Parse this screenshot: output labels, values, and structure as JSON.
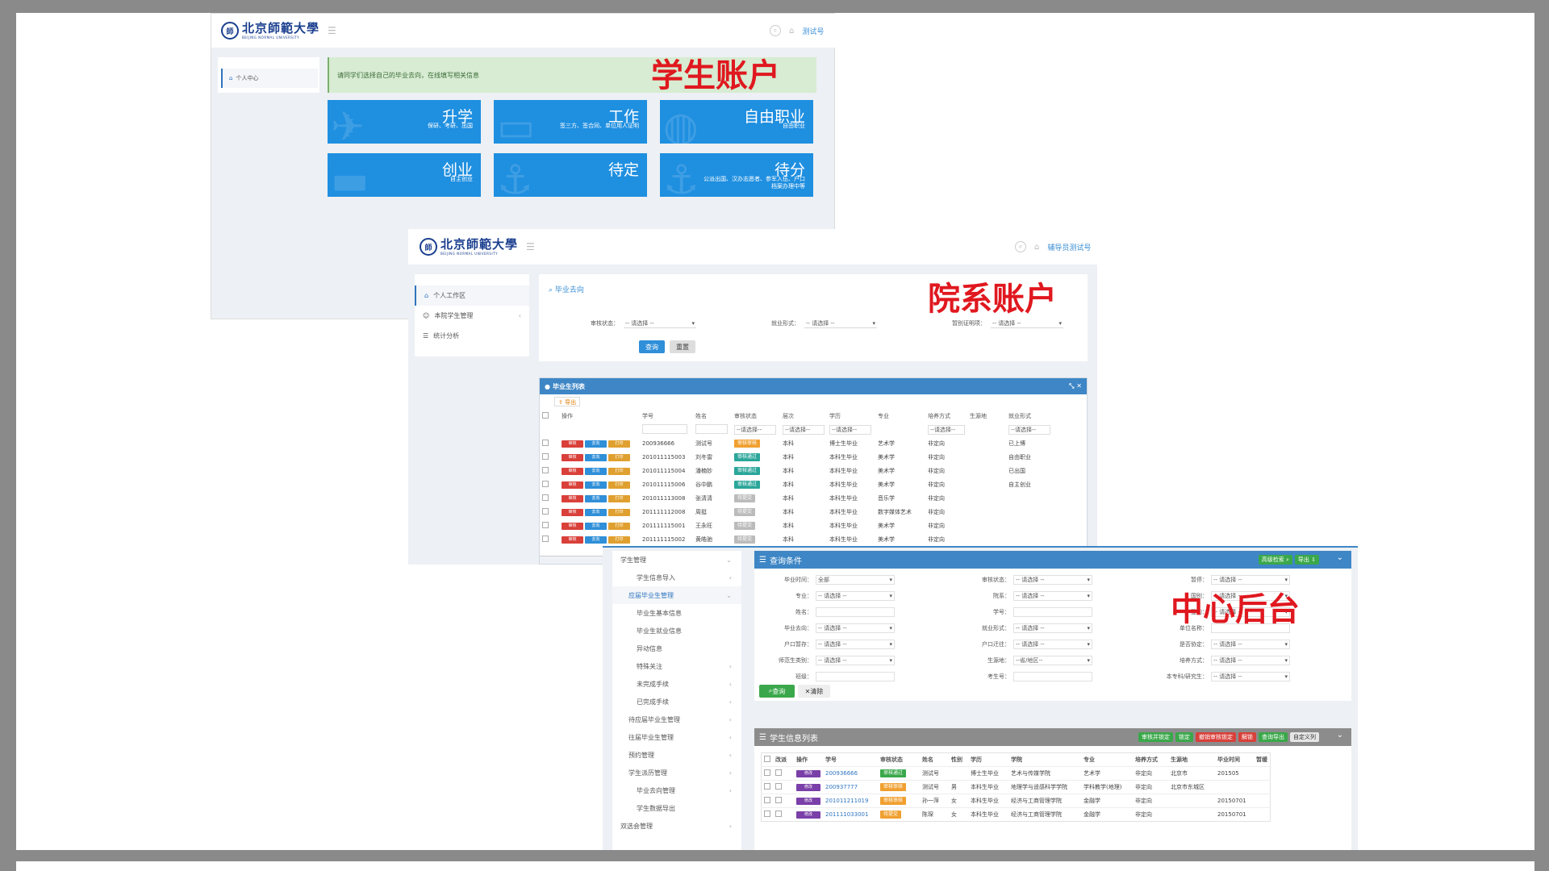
{
  "labels": {
    "student": "学生账户",
    "department": "院系账户",
    "center": "中心后台"
  },
  "logo": {
    "cn": "北京師範大學",
    "en": "BEIJING NORMAL UNIVERSITY"
  },
  "student": {
    "user": "测试号",
    "sidebar_item": "个人中心",
    "notice": "请同学们选择自己的毕业去向，在线填写相关信息",
    "tiles": [
      {
        "title": "升学",
        "sub": "保研、考研、出国"
      },
      {
        "title": "工作",
        "sub": "签三方、签合同、单位用人证明"
      },
      {
        "title": "自由职业",
        "sub": "自由职业"
      },
      {
        "title": "创业",
        "sub": "自主创业"
      },
      {
        "title": "待定",
        "sub": ""
      },
      {
        "title": "待分",
        "sub": "公派出国、汉办志愿者、参军入伍、户口档案办理中等"
      }
    ]
  },
  "department": {
    "user": "辅导员测试号",
    "sidebar": [
      "个人工作区",
      "本院学生管理",
      "统计分析"
    ],
    "search_title": "毕业去向",
    "filters": [
      {
        "label": "审核状态：",
        "value": "-- 请选择 --"
      },
      {
        "label": "就业形式：",
        "value": "-- 请选择 --"
      },
      {
        "label": "暂别证明项：",
        "value": "-- 请选择 --"
      }
    ],
    "btn_query": "查询",
    "btn_reset": "重置",
    "grid_title": "毕业生列表",
    "export": "导出",
    "columns": [
      "操作",
      "学号",
      "姓名",
      "审核状态",
      "层次",
      "学历",
      "专业",
      "培养方式",
      "生源地",
      "就业形式"
    ],
    "filter_value": "--请选择--",
    "op_labels": [
      "审核",
      "去向",
      "打印"
    ],
    "rows": [
      {
        "id": "200936666",
        "name": "测试号",
        "status": "审核审核",
        "status_color": "#f0a030",
        "level": "本科",
        "edu": "博士生毕业",
        "major": "艺术学",
        "mode": "非定向",
        "origin": "",
        "form": "已上博"
      },
      {
        "id": "201011115003",
        "name": "刘冬雷",
        "status": "审核通过",
        "status_color": "#2aa69a",
        "level": "本科",
        "edu": "本科生毕业",
        "major": "美术学",
        "mode": "非定向",
        "origin": "",
        "form": "自由职业"
      },
      {
        "id": "201011115004",
        "name": "潘楠妙",
        "status": "审核通过",
        "status_color": "#2aa69a",
        "level": "本科",
        "edu": "本科生毕业",
        "major": "美术学",
        "mode": "非定向",
        "origin": "",
        "form": "已出国"
      },
      {
        "id": "201011115006",
        "name": "谷中鹏",
        "status": "审核通过",
        "status_color": "#2aa69a",
        "level": "本科",
        "edu": "本科生毕业",
        "major": "美术学",
        "mode": "非定向",
        "origin": "",
        "form": "自主创业"
      },
      {
        "id": "201011113008",
        "name": "张清清",
        "status": "待提交",
        "status_color": "#bbbbbb",
        "level": "本科",
        "edu": "本科生毕业",
        "major": "音乐学",
        "mode": "非定向",
        "origin": "",
        "form": ""
      },
      {
        "id": "201111112008",
        "name": "周挺",
        "status": "待提交",
        "status_color": "#bbbbbb",
        "level": "本科",
        "edu": "本科生毕业",
        "major": "数字媒体艺术",
        "mode": "非定向",
        "origin": "",
        "form": ""
      },
      {
        "id": "201111115001",
        "name": "王永旺",
        "status": "待提交",
        "status_color": "#bbbbbb",
        "level": "本科",
        "edu": "本科生毕业",
        "major": "美术学",
        "mode": "非定向",
        "origin": "",
        "form": ""
      },
      {
        "id": "201111115002",
        "name": "黄皓驰",
        "status": "待提交",
        "status_color": "#bbbbbb",
        "level": "本科",
        "edu": "本科生毕业",
        "major": "美术学",
        "mode": "非定向",
        "origin": "",
        "form": ""
      }
    ]
  },
  "center": {
    "sidebar": [
      {
        "label": "学生管理",
        "indent": 0,
        "arrow": "⌄"
      },
      {
        "label": "学生信息导入",
        "indent": 2,
        "arrow": "‹"
      },
      {
        "label": "应届毕业生管理",
        "indent": 1,
        "arrow": "⌄"
      },
      {
        "label": "毕业生基本信息",
        "indent": 2,
        "arrow": ""
      },
      {
        "label": "毕业生就业信息",
        "indent": 2,
        "arrow": ""
      },
      {
        "label": "异动信息",
        "indent": 2,
        "arrow": ""
      },
      {
        "label": "特殊关注",
        "indent": 2,
        "arrow": "‹"
      },
      {
        "label": "未完成手续",
        "indent": 2,
        "arrow": "‹"
      },
      {
        "label": "已完成手续",
        "indent": 2,
        "arrow": "‹"
      },
      {
        "label": "待应届毕业生管理",
        "indent": 1,
        "arrow": "‹"
      },
      {
        "label": "往届毕业生管理",
        "indent": 1,
        "arrow": "‹"
      },
      {
        "label": "预约管理",
        "indent": 1,
        "arrow": "‹"
      },
      {
        "label": "学生派历管理",
        "indent": 1,
        "arrow": "‹"
      },
      {
        "label": "毕业去向管理",
        "indent": 2,
        "arrow": "‹"
      },
      {
        "label": "学生数据导出",
        "indent": 2,
        "arrow": ""
      },
      {
        "label": "双选会管理",
        "indent": 0,
        "arrow": "‹"
      }
    ],
    "query_title": "查询条件",
    "query_buttons": [
      "高级检索",
      "导出"
    ],
    "fields": [
      {
        "label": "毕业时间：",
        "value": "全部"
      },
      {
        "label": "审核状态：",
        "value": "-- 请选择 --"
      },
      {
        "label": "暂停：",
        "value": "-- 请选择 --"
      },
      {
        "label": "专业：",
        "value": "-- 请选择 --"
      },
      {
        "label": "院系：",
        "value": "-- 请选择 --"
      },
      {
        "label": "国别：",
        "value": "-- 请选择 --"
      },
      {
        "label": "姓名：",
        "value": ""
      },
      {
        "label": "学号：",
        "value": ""
      },
      {
        "label": "签约：",
        "value": "-- 请选择 --"
      },
      {
        "label": "毕业去向：",
        "value": "-- 请选择 --"
      },
      {
        "label": "就业形式：",
        "value": "-- 请选择 --"
      },
      {
        "label": "单位名称：",
        "value": ""
      },
      {
        "label": "户口暂存：",
        "value": "-- 请选择 --"
      },
      {
        "label": "户口迁往：",
        "value": "-- 请选择 --"
      },
      {
        "label": "是否协定：",
        "value": "-- 请选择 --"
      },
      {
        "label": "师范生类别：",
        "value": "-- 请选择 --"
      },
      {
        "label": "生源地：",
        "value": "--省/地区--"
      },
      {
        "label": "培养方式：",
        "value": "-- 请选择 --"
      },
      {
        "label": "班级：",
        "value": ""
      },
      {
        "label": "考生号：",
        "value": ""
      },
      {
        "label": "本专科/研究生：",
        "value": "-- 请选择 --"
      }
    ],
    "btn_query": "查询",
    "btn_clear": "清除",
    "list_title": "学生信息列表",
    "list_buttons": [
      {
        "label": "审核并锁定",
        "color": "#3aa84a"
      },
      {
        "label": "锁定",
        "color": "#3aa84a"
      },
      {
        "label": "撤销审核锁定",
        "color": "#d9403a"
      },
      {
        "label": "解锁",
        "color": "#d9403a"
      },
      {
        "label": "查询导出",
        "color": "#3aa84a"
      },
      {
        "label": "自定义列",
        "color": "#e6e6e6"
      }
    ],
    "columns": [
      "改派",
      "操作",
      "学号",
      "审核状态",
      "姓名",
      "性别",
      "学历",
      "学院",
      "专业",
      "培养方式",
      "生源地",
      "毕业时间",
      "暂缓"
    ],
    "edit_label": "修改",
    "rows": [
      {
        "id": "200936666",
        "status": "审核通过",
        "status_color": "#3aa84a",
        "name": "测试号",
        "gender": "",
        "edu": "博士生毕业",
        "college": "艺术与传媒学院",
        "major": "艺术学",
        "mode": "非定向",
        "origin": "北京市",
        "time": "201505"
      },
      {
        "id": "200937777",
        "status": "审核审核",
        "status_color": "#f0a030",
        "name": "测试号",
        "gender": "男",
        "edu": "本科生毕业",
        "college": "地理学与遥感科学学院",
        "major": "学科教学(地理)",
        "mode": "非定向",
        "origin": "北京市东城区",
        "time": ""
      },
      {
        "id": "201011211019",
        "status": "审核审核",
        "status_color": "#f0a030",
        "name": "孙一萍",
        "gender": "女",
        "edu": "本科生毕业",
        "college": "经济与工商管理学院",
        "major": "金融学",
        "mode": "非定向",
        "origin": "",
        "time": "20150701"
      },
      {
        "id": "201111033001",
        "status": "待提交",
        "status_color": "#f0a030",
        "name": "陈琛",
        "gender": "女",
        "edu": "本科生毕业",
        "college": "经济与工商管理学院",
        "major": "金融学",
        "mode": "非定向",
        "origin": "",
        "time": "20150701"
      }
    ]
  }
}
